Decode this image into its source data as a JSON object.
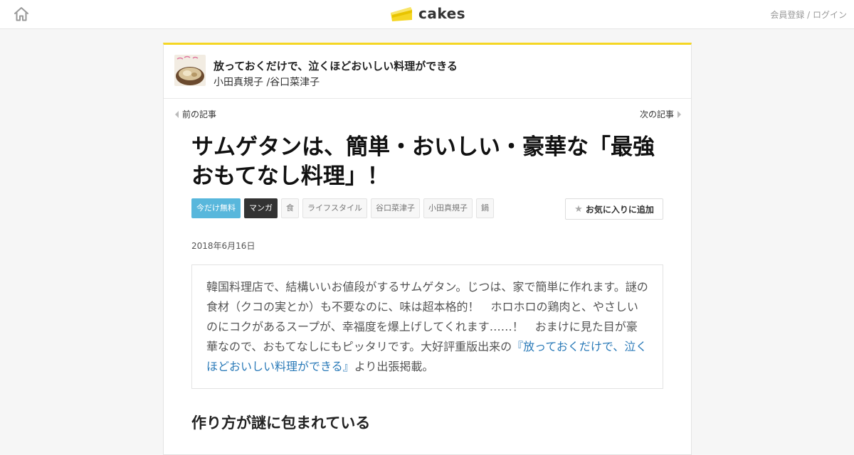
{
  "header": {
    "logo_text": "cakes",
    "auth_link": "会員登録 / ログイン",
    "accent_color": "#f5d623"
  },
  "series": {
    "title": "放っておくだけで、泣くほどおいしい料理ができる",
    "authors": "小田真規子 /谷口菜津子"
  },
  "nav": {
    "prev_label": "前の記事",
    "next_label": "次の記事"
  },
  "article": {
    "title": "サムゲタンは、簡単・おいしい・豪華な「最強おもてなし料理」！",
    "tags": [
      "今だけ無料",
      "マンガ",
      "食",
      "ライフスタイル",
      "谷口菜津子",
      "小田真規子",
      "鍋"
    ],
    "favorite_label": "お気に入りに追加",
    "date": "2018年6月16日",
    "lead_before": "韓国料理店で、結構いいお値段がするサムゲタン。じつは、家で簡単に作れます。謎の食材（クコの実とか）も不要なのに、味は超本格的！　ホロホロの鶏肉と、やさしいのにコクがあるスープが、幸福度を爆上げしてくれます……！　おまけに見た目が豪華なので、おもてなしにもピッタリです。大好評重版出来の",
    "lead_link": "『放っておくだけで、泣くほどおいしい料理ができる』",
    "lead_after": "より出張掲載。",
    "section_heading": "作り方が謎に包まれている"
  }
}
